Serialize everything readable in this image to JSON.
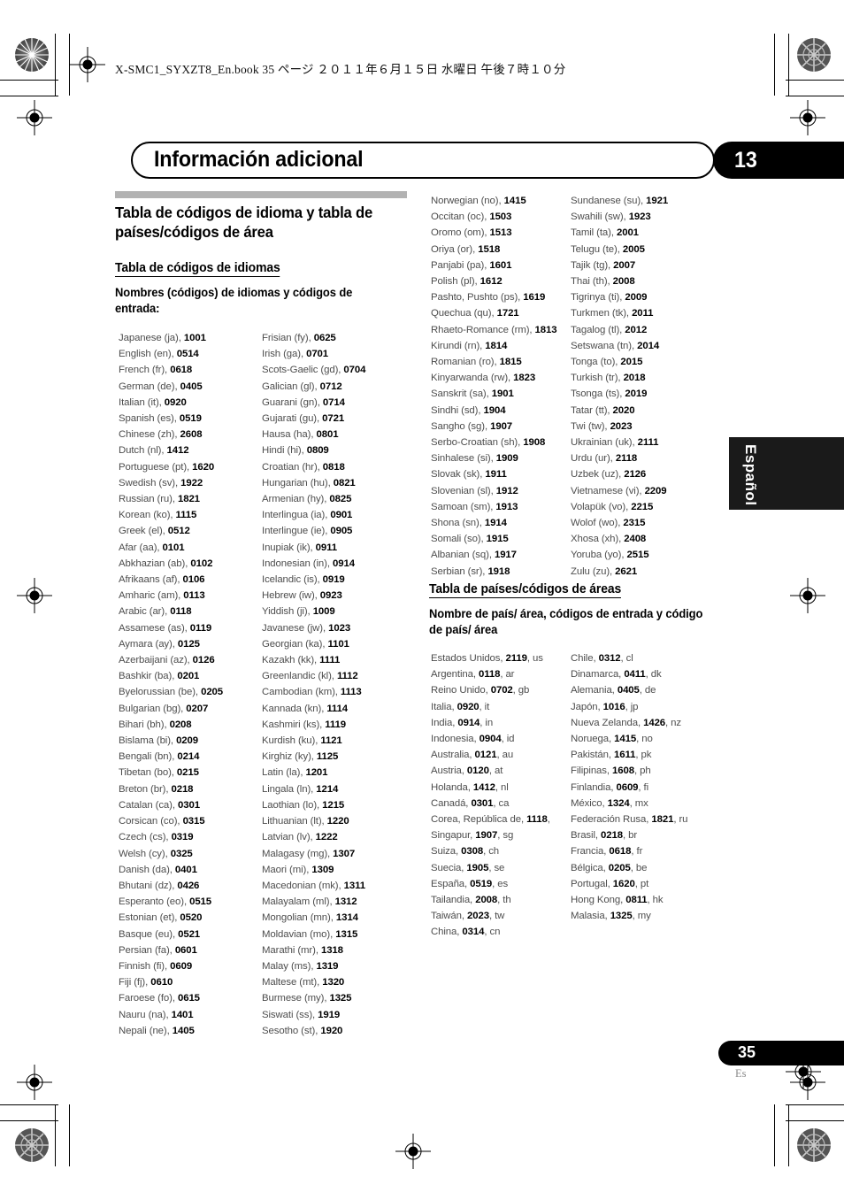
{
  "print_header": {
    "file_line": "X-SMC1_SYXZT8_En.book   35 ページ   ２０１１年６月１５日   水曜日   午後７時１０分"
  },
  "chapter": {
    "title": "Información adicional",
    "number": "13"
  },
  "section": {
    "heading": "Tabla de códigos de idioma y tabla de países/códigos de área",
    "lang_table_heading": "Tabla de códigos de idiomas",
    "lang_table_lead": "Nombres (códigos) de idiomas y códigos de entrada:",
    "country_table_heading": "Tabla de países/códigos de áreas",
    "country_table_lead": "Nombre de país/ área, códigos de entrada y código de país/ área"
  },
  "language_codes": {
    "col1": [
      {
        "name": "Japanese (ja),",
        "code": "1001"
      },
      {
        "name": "English (en),",
        "code": "0514"
      },
      {
        "name": "French (fr),",
        "code": "0618"
      },
      {
        "name": "German (de),",
        "code": "0405"
      },
      {
        "name": "Italian (it),",
        "code": "0920"
      },
      {
        "name": "Spanish (es),",
        "code": "0519"
      },
      {
        "name": "Chinese (zh),",
        "code": "2608"
      },
      {
        "name": "Dutch (nl),",
        "code": "1412"
      },
      {
        "name": "Portuguese (pt),",
        "code": "1620"
      },
      {
        "name": "Swedish (sv),",
        "code": "1922"
      },
      {
        "name": "Russian (ru),",
        "code": "1821"
      },
      {
        "name": "Korean (ko),",
        "code": "1115"
      },
      {
        "name": "Greek (el),",
        "code": "0512"
      },
      {
        "name": "Afar (aa),",
        "code": "0101"
      },
      {
        "name": "Abkhazian (ab),",
        "code": "0102"
      },
      {
        "name": "Afrikaans (af),",
        "code": "0106"
      },
      {
        "name": "Amharic (am),",
        "code": "0113"
      },
      {
        "name": "Arabic (ar),",
        "code": "0118"
      },
      {
        "name": "Assamese (as),",
        "code": "0119"
      },
      {
        "name": "Aymara (ay),",
        "code": "0125"
      },
      {
        "name": "Azerbaijani (az),",
        "code": "0126"
      },
      {
        "name": "Bashkir (ba),",
        "code": "0201"
      },
      {
        "name": "Byelorussian (be),",
        "code": "0205"
      },
      {
        "name": "Bulgarian (bg),",
        "code": "0207"
      },
      {
        "name": "Bihari (bh),",
        "code": "0208"
      },
      {
        "name": "Bislama (bi),",
        "code": "0209"
      },
      {
        "name": "Bengali (bn),",
        "code": "0214"
      },
      {
        "name": "Tibetan (bo),",
        "code": "0215"
      },
      {
        "name": "Breton (br),",
        "code": "0218"
      },
      {
        "name": "Catalan (ca),",
        "code": "0301"
      },
      {
        "name": "Corsican (co),",
        "code": "0315"
      },
      {
        "name": "Czech (cs),",
        "code": "0319"
      },
      {
        "name": "Welsh (cy),",
        "code": "0325"
      },
      {
        "name": "Danish (da),",
        "code": "0401"
      },
      {
        "name": "Bhutani (dz),",
        "code": "0426"
      },
      {
        "name": "Esperanto (eo),",
        "code": "0515"
      },
      {
        "name": "Estonian (et),",
        "code": "0520"
      },
      {
        "name": "Basque (eu),",
        "code": "0521"
      },
      {
        "name": "Persian (fa),",
        "code": "0601"
      },
      {
        "name": "Finnish (fi),",
        "code": "0609"
      },
      {
        "name": "Fiji (fj),",
        "code": "0610"
      },
      {
        "name": "Faroese (fo),",
        "code": "0615"
      },
      {
        "name": "Nauru (na),",
        "code": "1401"
      },
      {
        "name": "Nepali (ne),",
        "code": "1405"
      }
    ],
    "col2": [
      {
        "name": "Frisian (fy),",
        "code": "0625"
      },
      {
        "name": "Irish (ga),",
        "code": "0701"
      },
      {
        "name": "Scots-Gaelic (gd),",
        "code": "0704"
      },
      {
        "name": "Galician (gl),",
        "code": "0712"
      },
      {
        "name": "Guarani (gn),",
        "code": "0714"
      },
      {
        "name": "Gujarati (gu),",
        "code": "0721"
      },
      {
        "name": "Hausa (ha),",
        "code": "0801"
      },
      {
        "name": "Hindi (hi),",
        "code": "0809"
      },
      {
        "name": "Croatian (hr),",
        "code": "0818"
      },
      {
        "name": "Hungarian (hu),",
        "code": "0821"
      },
      {
        "name": "Armenian (hy),",
        "code": "0825"
      },
      {
        "name": "Interlingua (ia),",
        "code": "0901"
      },
      {
        "name": "Interlingue (ie),",
        "code": "0905"
      },
      {
        "name": "Inupiak (ik),",
        "code": "0911"
      },
      {
        "name": "Indonesian (in),",
        "code": "0914"
      },
      {
        "name": "Icelandic (is),",
        "code": "0919"
      },
      {
        "name": "Hebrew (iw),",
        "code": "0923"
      },
      {
        "name": "Yiddish (ji),",
        "code": "1009"
      },
      {
        "name": "Javanese (jw),",
        "code": "1023"
      },
      {
        "name": "Georgian (ka),",
        "code": "1101"
      },
      {
        "name": "Kazakh (kk),",
        "code": "1111"
      },
      {
        "name": "Greenlandic (kl),",
        "code": "1112"
      },
      {
        "name": "Cambodian (km),",
        "code": "1113"
      },
      {
        "name": "Kannada (kn),",
        "code": "1114"
      },
      {
        "name": "Kashmiri (ks),",
        "code": "1119"
      },
      {
        "name": "Kurdish (ku),",
        "code": "1121"
      },
      {
        "name": "Kirghiz (ky),",
        "code": "1125"
      },
      {
        "name": "Latin (la),",
        "code": "1201"
      },
      {
        "name": "Lingala (ln),",
        "code": "1214"
      },
      {
        "name": "Laothian (lo),",
        "code": "1215"
      },
      {
        "name": "Lithuanian (lt),",
        "code": "1220"
      },
      {
        "name": "Latvian (lv),",
        "code": "1222"
      },
      {
        "name": "Malagasy (mg),",
        "code": "1307"
      },
      {
        "name": "Maori (mi),",
        "code": "1309"
      },
      {
        "name": "Macedonian (mk),",
        "code": "1311"
      },
      {
        "name": "Malayalam (ml),",
        "code": "1312"
      },
      {
        "name": "Mongolian (mn),",
        "code": "1314"
      },
      {
        "name": "Moldavian (mo),",
        "code": "1315"
      },
      {
        "name": "Marathi (mr),",
        "code": "1318"
      },
      {
        "name": "Malay (ms),",
        "code": "1319"
      },
      {
        "name": "Maltese (mt),",
        "code": "1320"
      },
      {
        "name": "Burmese (my),",
        "code": "1325"
      },
      {
        "name": "Siswati (ss),",
        "code": "1919"
      },
      {
        "name": "Sesotho (st),",
        "code": "1920"
      }
    ],
    "col3": [
      {
        "name": "Norwegian (no),",
        "code": "1415"
      },
      {
        "name": "Occitan (oc),",
        "code": "1503"
      },
      {
        "name": "Oromo (om),",
        "code": "1513"
      },
      {
        "name": "Oriya (or),",
        "code": "1518"
      },
      {
        "name": "Panjabi (pa),",
        "code": "1601"
      },
      {
        "name": "Polish (pl),",
        "code": "1612"
      },
      {
        "name": "Pashto, Pushto (ps),",
        "code": "1619"
      },
      {
        "name": "Quechua (qu),",
        "code": "1721"
      },
      {
        "name": "Rhaeto-Romance (rm),",
        "code": "1813"
      },
      {
        "name": "Kirundi (rn),",
        "code": "1814"
      },
      {
        "name": "Romanian (ro),",
        "code": "1815"
      },
      {
        "name": "Kinyarwanda (rw),",
        "code": "1823"
      },
      {
        "name": "Sanskrit (sa),",
        "code": "1901"
      },
      {
        "name": "Sindhi (sd),",
        "code": "1904"
      },
      {
        "name": "Sangho (sg),",
        "code": "1907"
      },
      {
        "name": "Serbo-Croatian (sh),",
        "code": "1908"
      },
      {
        "name": "Sinhalese (si),",
        "code": "1909"
      },
      {
        "name": "Slovak (sk),",
        "code": "1911"
      },
      {
        "name": "Slovenian (sl),",
        "code": "1912"
      },
      {
        "name": "Samoan (sm),",
        "code": "1913"
      },
      {
        "name": "Shona (sn),",
        "code": "1914"
      },
      {
        "name": "Somali (so),",
        "code": "1915"
      },
      {
        "name": "Albanian (sq),",
        "code": "1917"
      },
      {
        "name": "Serbian (sr),",
        "code": "1918"
      }
    ],
    "col4": [
      {
        "name": "Sundanese (su),",
        "code": "1921"
      },
      {
        "name": "Swahili (sw),",
        "code": "1923"
      },
      {
        "name": "Tamil (ta),",
        "code": "2001"
      },
      {
        "name": "Telugu (te),",
        "code": "2005"
      },
      {
        "name": "Tajik (tg),",
        "code": "2007"
      },
      {
        "name": "Thai (th),",
        "code": "2008"
      },
      {
        "name": "Tigrinya (ti),",
        "code": "2009"
      },
      {
        "name": "Turkmen (tk),",
        "code": "2011"
      },
      {
        "name": "Tagalog (tl),",
        "code": "2012"
      },
      {
        "name": "Setswana (tn),",
        "code": "2014"
      },
      {
        "name": "Tonga (to),",
        "code": "2015"
      },
      {
        "name": "Turkish (tr),",
        "code": "2018"
      },
      {
        "name": "Tsonga (ts),",
        "code": "2019"
      },
      {
        "name": "Tatar (tt),",
        "code": "2020"
      },
      {
        "name": "Twi (tw),",
        "code": "2023"
      },
      {
        "name": "Ukrainian (uk),",
        "code": "2111"
      },
      {
        "name": "Urdu (ur),",
        "code": "2118"
      },
      {
        "name": "Uzbek (uz),",
        "code": "2126"
      },
      {
        "name": "Vietnamese (vi),",
        "code": "2209"
      },
      {
        "name": "Volapük (vo),",
        "code": "2215"
      },
      {
        "name": "Wolof (wo),",
        "code": "2315"
      },
      {
        "name": "Xhosa (xh),",
        "code": "2408"
      },
      {
        "name": "Yoruba (yo),",
        "code": "2515"
      },
      {
        "name": "Zulu (zu),",
        "code": "2621"
      }
    ]
  },
  "country_codes": {
    "col1": [
      {
        "name": "Estados Unidos,",
        "code": "2119",
        "abbr": ", us"
      },
      {
        "name": "Argentina,",
        "code": "0118",
        "abbr": ", ar"
      },
      {
        "name": "Reino Unido,",
        "code": "0702",
        "abbr": ", gb"
      },
      {
        "name": "Italia,",
        "code": "0920",
        "abbr": ", it"
      },
      {
        "name": "India,",
        "code": "0914",
        "abbr": ", in"
      },
      {
        "name": "Indonesia,",
        "code": "0904",
        "abbr": ", id"
      },
      {
        "name": "Australia,",
        "code": "0121",
        "abbr": ", au"
      },
      {
        "name": "Austria,",
        "code": "0120",
        "abbr": ", at"
      },
      {
        "name": "Holanda,",
        "code": "1412",
        "abbr": ", nl"
      },
      {
        "name": "Canadá,",
        "code": "0301",
        "abbr": ", ca"
      },
      {
        "name": "Corea, República de,",
        "code": "1118",
        "abbr": ","
      },
      {
        "name": "Singapur,",
        "code": "1907",
        "abbr": ", sg"
      },
      {
        "name": "Suiza,",
        "code": "0308",
        "abbr": ", ch"
      },
      {
        "name": "Suecia,",
        "code": "1905",
        "abbr": ", se"
      },
      {
        "name": "España,",
        "code": "0519",
        "abbr": ", es"
      },
      {
        "name": "Tailandia,",
        "code": "2008",
        "abbr": ", th"
      },
      {
        "name": "Taiwán,",
        "code": "2023",
        "abbr": ", tw"
      },
      {
        "name": "China,",
        "code": "0314",
        "abbr": ", cn"
      }
    ],
    "col2": [
      {
        "name": "Chile,",
        "code": "0312",
        "abbr": ", cl"
      },
      {
        "name": "Dinamarca,",
        "code": "0411",
        "abbr": ", dk"
      },
      {
        "name": "Alemania,",
        "code": "0405",
        "abbr": ", de"
      },
      {
        "name": "Japón,",
        "code": "1016",
        "abbr": ", jp"
      },
      {
        "name": "Nueva Zelanda,",
        "code": "1426",
        "abbr": ", nz"
      },
      {
        "name": "Noruega,",
        "code": "1415",
        "abbr": ", no"
      },
      {
        "name": "Pakistán,",
        "code": "1611",
        "abbr": ", pk"
      },
      {
        "name": "Filipinas,",
        "code": "1608",
        "abbr": ", ph"
      },
      {
        "name": "Finlandia,",
        "code": "0609",
        "abbr": ", fi"
      },
      {
        "name": "México,",
        "code": "1324",
        "abbr": ", mx"
      },
      {
        "name": "Federación Rusa,",
        "code": "1821",
        "abbr": ", ru"
      },
      {
        "name": "Brasil,",
        "code": "0218",
        "abbr": ", br"
      },
      {
        "name": "Francia,",
        "code": "0618",
        "abbr": ", fr"
      },
      {
        "name": "Bélgica,",
        "code": "0205",
        "abbr": ", be"
      },
      {
        "name": "Portugal,",
        "code": "1620",
        "abbr": ", pt"
      },
      {
        "name": "Hong Kong,",
        "code": "0811",
        "abbr": ", hk"
      },
      {
        "name": "Malasia,",
        "code": "1325",
        "abbr": ", my"
      }
    ]
  },
  "side_tab": {
    "label": "Español"
  },
  "footer": {
    "page_number": "35",
    "language_code": "Es"
  },
  "colors": {
    "gray_bar": "#b2b2b2",
    "body_text": "#4d4d4d",
    "black": "#000000",
    "tab_black": "#1a1a1a"
  }
}
